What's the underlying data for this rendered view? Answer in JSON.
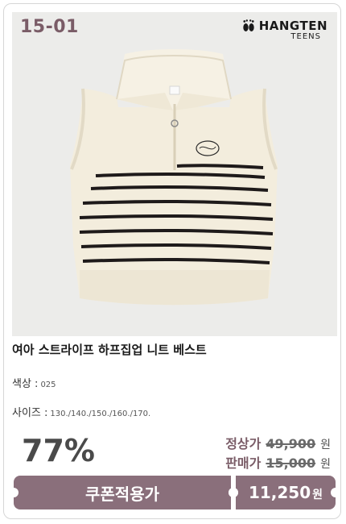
{
  "product": {
    "code": "15-01",
    "brand": {
      "name": "HANGTEN",
      "sub": "TEENS"
    },
    "title": "여아 스트라이프 하프집업 니트 베스트",
    "color": {
      "label": "색상 :",
      "value": "025"
    },
    "size": {
      "label": "사이즈 :",
      "value": "130./140./150./160./170."
    }
  },
  "pricing": {
    "discount": "77%",
    "regular": {
      "label": "정상가",
      "value": "49,900",
      "currency": "원"
    },
    "sale": {
      "label": "판매가",
      "value": "15,000",
      "currency": "원"
    },
    "coupon_label": "쿠폰적용가",
    "final": {
      "value": "11,250",
      "currency": "원"
    }
  },
  "colors": {
    "accent": "#8a6f7b",
    "photo_bg": "#ececea",
    "knit": "#f3eddd",
    "stripe": "#1e1a1a"
  }
}
